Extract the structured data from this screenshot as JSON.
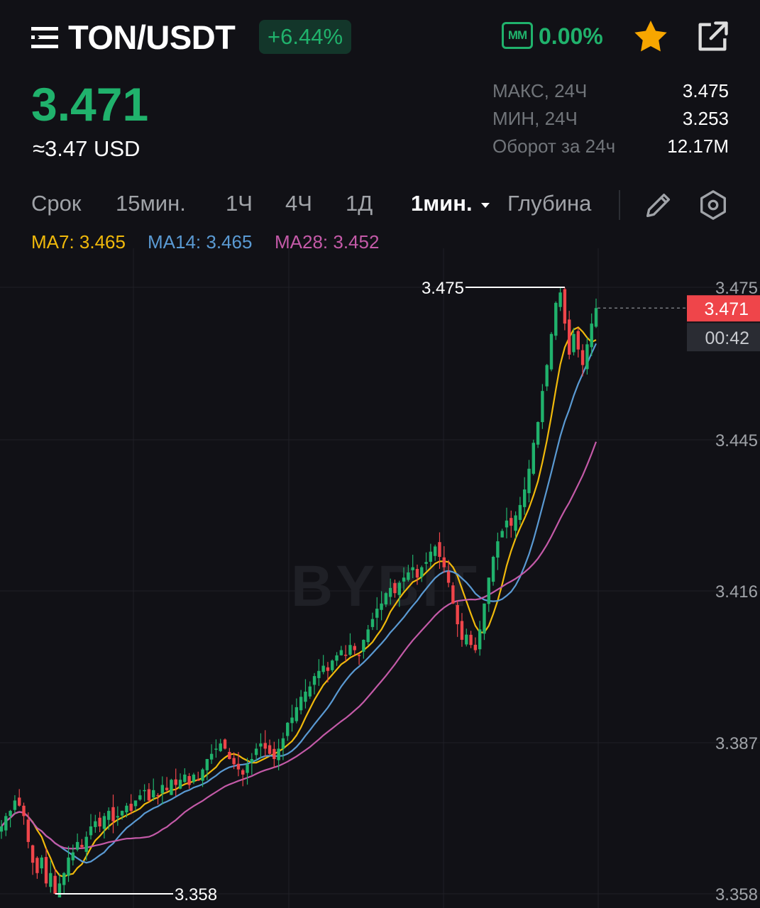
{
  "header": {
    "pair": "TON/USDT",
    "change_pct": "+6.44%",
    "mm_label": "ММ",
    "mm_value": "0.00%",
    "icons": [
      "menu-icon",
      "star-icon",
      "share-icon"
    ],
    "star_color": "#f7a600"
  },
  "price": {
    "last": "3.471",
    "usd": "≈3.47 USD"
  },
  "stats": [
    {
      "label": "МАКС, 24Ч",
      "value": "3.475"
    },
    {
      "label": "МИН, 24Ч",
      "value": "3.253"
    },
    {
      "label": "Оборот за 24ч",
      "value": "12.17M"
    }
  ],
  "timeframes": {
    "items": [
      "Срок",
      "15мин.",
      "1Ч",
      "4Ч",
      "1Д",
      "1мин.",
      "Глубина"
    ],
    "active": "1мин."
  },
  "ma_legend": [
    {
      "label": "MA7: 3.465",
      "color": "#f0b90b"
    },
    {
      "label": "MA14: 3.465",
      "color": "#5a9ad3"
    },
    {
      "label": "MA28: 3.452",
      "color": "#c45aa8"
    }
  ],
  "watermark": "BYBIT",
  "colors": {
    "up": "#20b26c",
    "down": "#ef454a",
    "background": "#111116"
  },
  "chart_data": {
    "type": "candlestick",
    "interval": "1m",
    "y_ticks": [
      "3.475",
      "3.445",
      "3.416",
      "3.387",
      "3.358"
    ],
    "ylim": [
      3.357,
      3.478
    ],
    "grid": true,
    "high_marker": "3.475",
    "low_marker": "3.358",
    "current_price": "3.471",
    "countdown": "00:42",
    "close_series": [
      3.371,
      3.373,
      3.374,
      3.376,
      3.375,
      3.373,
      3.368,
      3.364,
      3.362,
      3.365,
      3.36,
      3.362,
      3.358,
      3.36,
      3.362,
      3.365,
      3.366,
      3.368,
      3.367,
      3.369,
      3.371,
      3.372,
      3.371,
      3.373,
      3.374,
      3.372,
      3.373,
      3.374,
      3.375,
      3.374,
      3.376,
      3.377,
      3.378,
      3.376,
      3.378,
      3.377,
      3.379,
      3.378,
      3.38,
      3.379,
      3.38,
      3.381,
      3.379,
      3.381,
      3.38,
      3.382,
      3.384,
      3.385,
      3.386,
      3.387,
      3.386,
      3.384,
      3.383,
      3.382,
      3.381,
      3.383,
      3.384,
      3.386,
      3.387,
      3.386,
      3.385,
      3.384,
      3.386,
      3.388,
      3.391,
      3.392,
      3.394,
      3.396,
      3.397,
      3.398,
      3.4,
      3.401,
      3.402,
      3.401,
      3.403,
      3.404,
      3.405,
      3.404,
      3.406,
      3.405,
      3.404,
      3.407,
      3.409,
      3.411,
      3.413,
      3.414,
      3.416,
      3.417,
      3.416,
      3.418,
      3.419,
      3.42,
      3.421,
      3.419,
      3.421,
      3.422,
      3.424,
      3.425,
      3.423,
      3.421,
      3.418,
      3.414,
      3.41,
      3.407,
      3.408,
      3.406,
      3.405,
      3.409,
      3.414,
      3.419,
      3.423,
      3.426,
      3.428,
      3.43,
      3.429,
      3.431,
      3.433,
      3.436,
      3.44,
      3.445,
      3.449,
      3.455,
      3.46,
      3.466,
      3.472,
      3.474,
      3.468,
      3.462,
      3.466,
      3.463,
      3.46,
      3.464,
      3.468,
      3.471
    ],
    "ma_series": [
      {
        "name": "MA7",
        "last": 3.465
      },
      {
        "name": "MA14",
        "last": 3.465
      },
      {
        "name": "MA28",
        "last": 3.452
      }
    ]
  }
}
